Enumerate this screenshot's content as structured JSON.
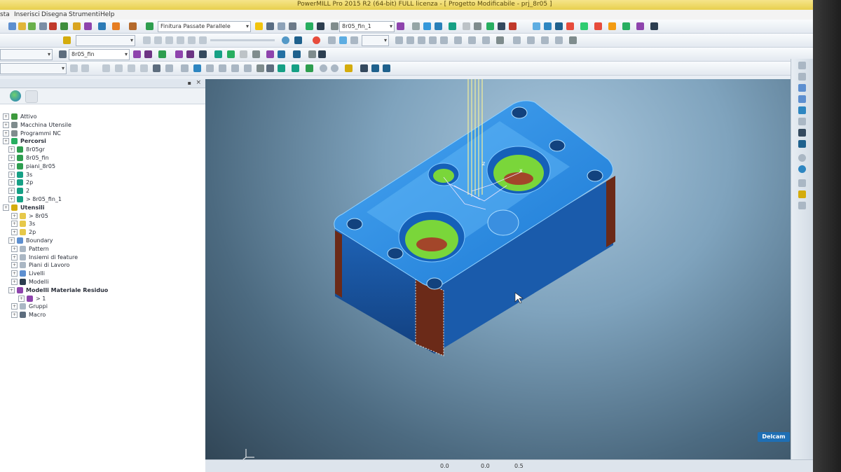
{
  "window": {
    "title": "PowerMILL Pro 2015 R2 (64-bit) FULL licenza - [ Progetto Modificabile - prj_8r05 ]"
  },
  "menu": [
    "sta",
    "Inserisci",
    "Disegna",
    "Strumenti",
    "Help"
  ],
  "toolbar": {
    "strategy_combo": "Finitura Passate Parallele",
    "toolpath_combo": "8r05_fin_1",
    "tool_combo": "8r05_fin"
  },
  "tree": {
    "items": [
      {
        "label": "Attivo",
        "bold": false
      },
      {
        "label": "Macchina Utensile",
        "bold": false
      },
      {
        "label": "Programmi NC",
        "bold": false
      },
      {
        "label": "Percorsi",
        "bold": true
      },
      {
        "label": "8r05gr",
        "bold": false
      },
      {
        "label": "8r05_fin",
        "bold": false
      },
      {
        "label": "piani_8r05",
        "bold": false
      },
      {
        "label": "3s",
        "bold": false
      },
      {
        "label": "2p",
        "bold": false
      },
      {
        "label": "2",
        "bold": false
      },
      {
        "label": "> 8r05_fin_1",
        "bold": false
      },
      {
        "label": "Utensili",
        "bold": true
      },
      {
        "label": "> 8r05",
        "bold": false
      },
      {
        "label": "3s",
        "bold": false
      },
      {
        "label": "2p",
        "bold": false
      },
      {
        "label": "Boundary",
        "bold": false
      },
      {
        "label": "Pattern",
        "bold": false
      },
      {
        "label": "Insiemi di feature",
        "bold": false
      },
      {
        "label": "Piani di Lavoro",
        "bold": false
      },
      {
        "label": "Livelli",
        "bold": false
      },
      {
        "label": "Modelli",
        "bold": false
      },
      {
        "label": "Modelli Materiale Residuo",
        "bold": true
      },
      {
        "label": "> 1",
        "bold": false
      },
      {
        "label": "Gruppi",
        "bold": false
      },
      {
        "label": "Macro",
        "bold": false
      }
    ]
  },
  "status": {
    "val1": "0.0",
    "val2": "0.0",
    "val3": "0.5"
  },
  "brand": {
    "logo": "Delcam"
  },
  "colors": {
    "part": "#1e7ed8",
    "pocket": "#7ad63a",
    "wall": "#7a2a1a",
    "accent": "#1f6fb4"
  }
}
